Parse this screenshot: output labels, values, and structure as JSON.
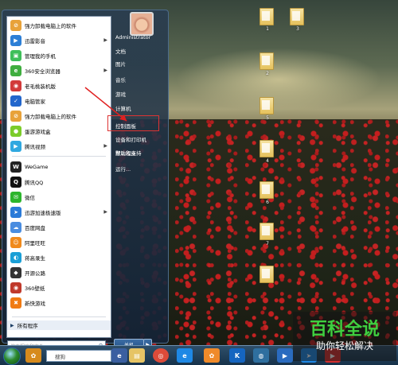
{
  "start_menu": {
    "programs": [
      {
        "label": "强力卸载电脑上的软件",
        "icon": "uninstall-icon",
        "color": "#e8a23a",
        "arrow": false
      },
      {
        "label": "迅雷影音",
        "icon": "thunder-player-icon",
        "color": "#2d7fd6",
        "arrow": true
      },
      {
        "label": "管理我的手机",
        "icon": "phone-manager-icon",
        "color": "#3fbf5a",
        "arrow": false
      },
      {
        "label": "360安全浏览器",
        "icon": "360-browser-icon",
        "color": "#3fae3f",
        "arrow": true
      },
      {
        "label": "老毛桃装机版",
        "icon": "laomaotao-icon",
        "color": "#d23a3a",
        "arrow": false
      },
      {
        "label": "电脑管家",
        "icon": "pc-manager-icon",
        "color": "#2266cc",
        "arrow": false
      },
      {
        "label": "强力卸载电脑上的软件",
        "icon": "uninstall-icon",
        "color": "#e8a23a",
        "arrow": false
      },
      {
        "label": "蛋游游戏盒",
        "icon": "game-box-icon",
        "color": "#7ccc2a",
        "arrow": false
      },
      {
        "label": "腾讯视频",
        "icon": "tencent-video-icon",
        "color": "#2fa8e0",
        "arrow": true
      },
      {
        "label": "WeGame",
        "icon": "wegame-icon",
        "color": "#222222",
        "arrow": false
      },
      {
        "label": "腾讯QQ",
        "icon": "qq-icon",
        "color": "#111111",
        "arrow": false
      },
      {
        "label": "微信",
        "icon": "wechat-icon",
        "color": "#2cb52c",
        "arrow": false
      },
      {
        "label": "迅游加速极速版",
        "icon": "accelerator-icon",
        "color": "#2b7bd8",
        "arrow": true
      },
      {
        "label": "百度网盘",
        "icon": "baidu-netdisk-icon",
        "color": "#4a8de0",
        "arrow": false
      },
      {
        "label": "阿里旺旺",
        "icon": "aliwangwang-icon",
        "color": "#f08a1c",
        "arrow": false
      },
      {
        "label": "蒋高录生",
        "icon": "recorder-icon",
        "color": "#1a9fd6",
        "arrow": false
      },
      {
        "label": "开源公路",
        "icon": "unity-icon",
        "color": "#333333",
        "arrow": false
      },
      {
        "label": "360壁纸",
        "icon": "360-wallpaper-icon",
        "color": "#c0392b",
        "arrow": false
      },
      {
        "label": "新快游戏",
        "icon": "xinkuai-game-icon",
        "color": "#f07a12",
        "arrow": false
      }
    ],
    "all_programs": "所有程序",
    "search_placeholder": "搜索程序和文件",
    "right_items": [
      {
        "label": "Administrator",
        "name": "right-item-administrator"
      },
      {
        "label": "文档",
        "name": "right-item-documents"
      },
      {
        "label": "图片",
        "name": "right-item-pictures"
      },
      {
        "label": "音乐",
        "name": "right-item-music"
      },
      {
        "label": "游戏",
        "name": "right-item-games"
      },
      {
        "label": "计算机",
        "name": "right-item-computer"
      },
      {
        "label": "控制面板",
        "name": "right-item-control-panel"
      },
      {
        "label": "设备和打印机",
        "name": "right-item-devices-printers"
      },
      {
        "label": "默认程序",
        "name": "right-item-default-programs"
      },
      {
        "label": "帮助和支持",
        "name": "right-item-help"
      },
      {
        "label": "运行...",
        "name": "right-item-run"
      }
    ],
    "shutdown_label": "关机",
    "shutdown_arrow": "▶"
  },
  "desktop_icons": [
    {
      "label": "1"
    },
    {
      "label": "3"
    },
    {
      "label": "2"
    },
    {
      "label": "5"
    },
    {
      "label": "4"
    },
    {
      "label": "6"
    },
    {
      "label": "7"
    }
  ],
  "taskbar": {
    "search_text": "搜狗",
    "buttons": [
      "ie-icon",
      "folder-icon",
      "chrome-icon",
      "edge-icon",
      "pinwheel-icon",
      "k-icon",
      "globe-icon",
      "media-player-icon",
      "arrow-icon",
      "video-icon"
    ]
  },
  "watermark": {
    "title": "百科全说",
    "subtitle": "助你轻松解决"
  }
}
